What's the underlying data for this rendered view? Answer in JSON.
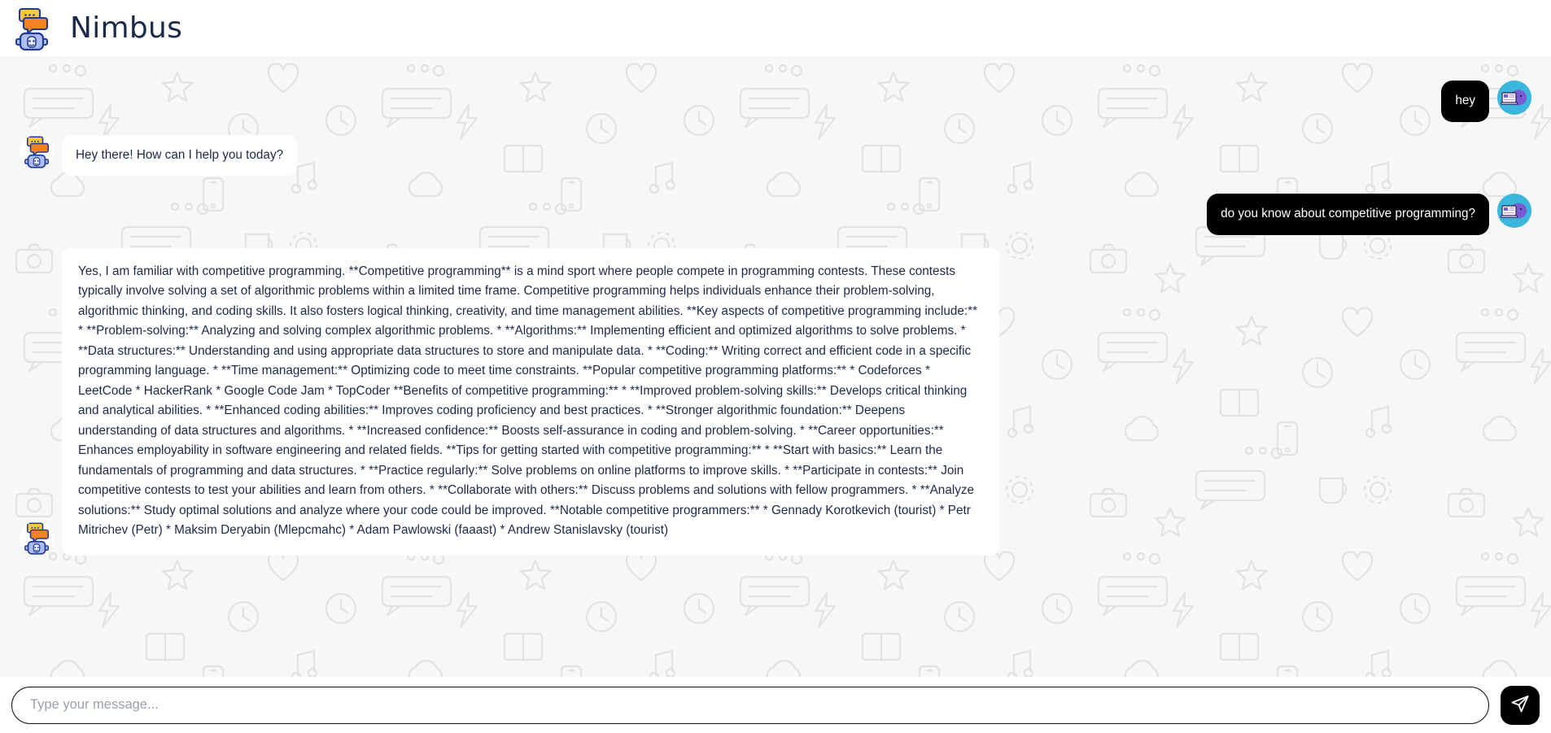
{
  "app": {
    "title": "Nimbus",
    "logo_icon": "chat-robot-logo-icon",
    "accent_dark": "#000000",
    "brand_text_color": "#1b2a4a",
    "bot_bubble_color": "#ffffff",
    "user_bubble_color": "#000000",
    "user_avatar_bg": "#3bb7dd",
    "chat_background_color": "#f7f7f8"
  },
  "header": {
    "title": "Nimbus"
  },
  "messages": [
    {
      "id": "m1",
      "role": "user",
      "text": "hey",
      "avatar_icon": "purple-cat-avatar-icon"
    },
    {
      "id": "m2",
      "role": "bot",
      "text": "Hey there! How can I help you today?",
      "avatar_icon": "chat-robot-avatar-icon"
    },
    {
      "id": "m3",
      "role": "user",
      "text": "do you know about competitive programming?",
      "avatar_icon": "purple-cat-avatar-icon"
    },
    {
      "id": "m4",
      "role": "bot",
      "avatar_icon": "chat-robot-avatar-icon",
      "text": "Yes, I am familiar with competitive programming. **Competitive programming** is a mind sport where people compete in programming contests. These contests typically involve solving a set of algorithmic problems within a limited time frame. Competitive programming helps individuals enhance their problem-solving, algorithmic thinking, and coding skills. It also fosters logical thinking, creativity, and time management abilities. **Key aspects of competitive programming include:** * **Problem-solving:** Analyzing and solving complex algorithmic problems. * **Algorithms:** Implementing efficient and optimized algorithms to solve problems. * **Data structures:** Understanding and using appropriate data structures to store and manipulate data. * **Coding:** Writing correct and efficient code in a specific programming language. * **Time management:** Optimizing code to meet time constraints. **Popular competitive programming platforms:** * Codeforces * LeetCode * HackerRank * Google Code Jam * TopCoder **Benefits of competitive programming:** * **Improved problem-solving skills:** Develops critical thinking and analytical abilities. * **Enhanced coding abilities:** Improves coding proficiency and best practices. * **Stronger algorithmic foundation:** Deepens understanding of data structures and algorithms. * **Increased confidence:** Boosts self-assurance in coding and problem-solving. * **Career opportunities:** Enhances employability in software engineering and related fields. **Tips for getting started with competitive programming:** * **Start with basics:** Learn the fundamentals of programming and data structures. * **Practice regularly:** Solve problems on online platforms to improve skills. * **Participate in contests:** Join competitive contests to test your abilities and learn from others. * **Collaborate with others:** Discuss problems and solutions with fellow programmers. * **Analyze solutions:** Study optimal solutions and analyze where your code could be improved. **Notable competitive programmers:** * Gennady Korotkevich (tourist) * Petr Mitrichev (Petr) * Maksim Deryabin (Mlepcmahc) * Adam Pawlowski (faaast) * Andrew Stanislavsky (tourist)"
    }
  ],
  "composer": {
    "placeholder": "Type your message...",
    "value": "",
    "send_icon": "send-paper-plane-icon",
    "send_label": "Send"
  }
}
